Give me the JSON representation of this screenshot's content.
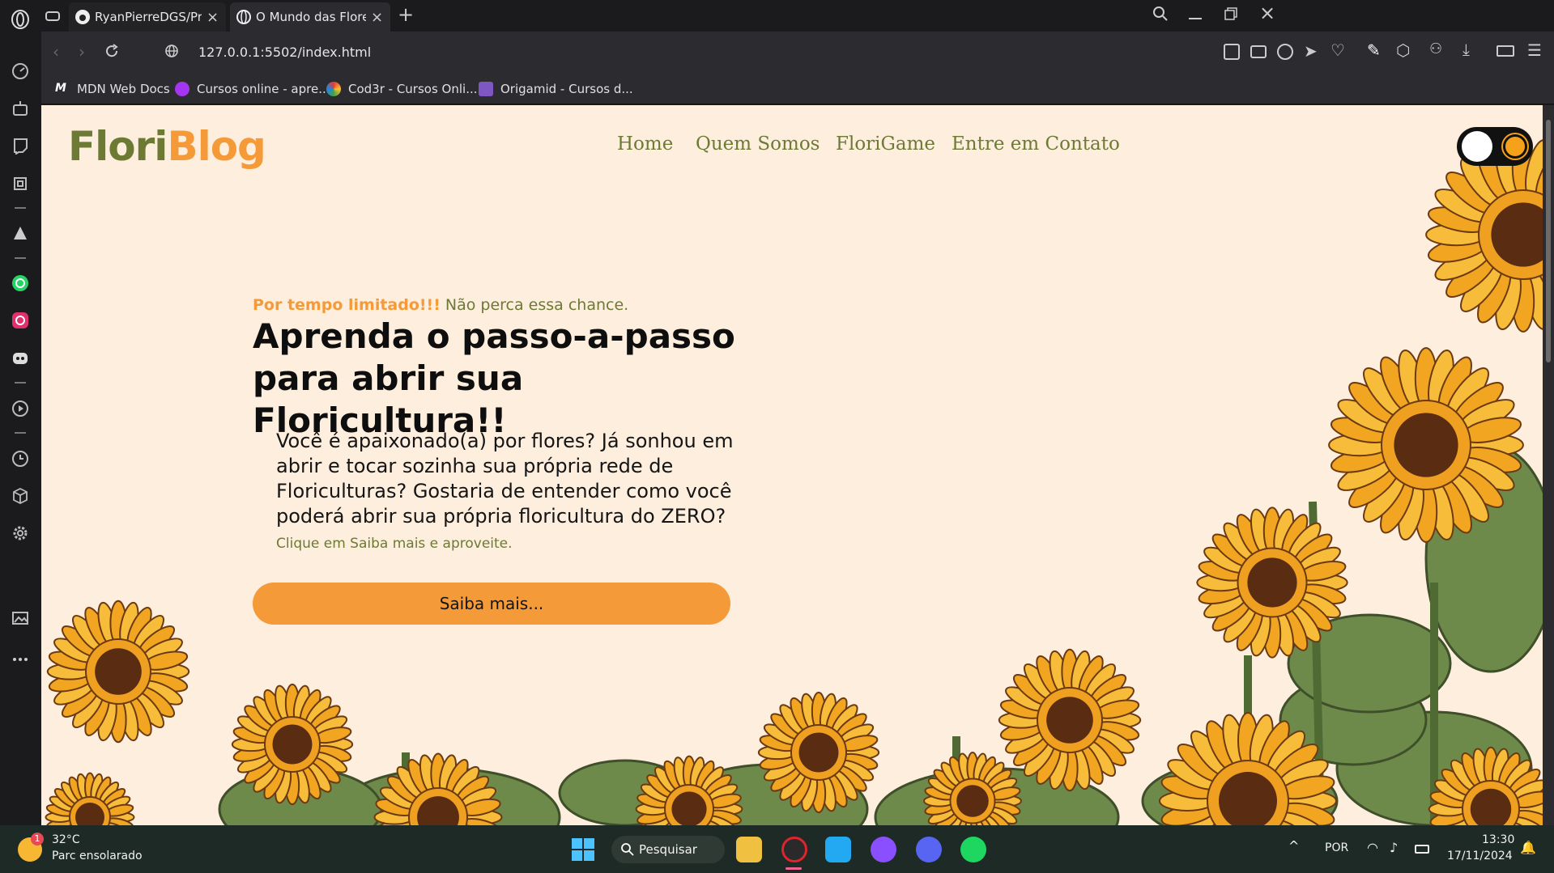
{
  "browser": {
    "tabs": [
      {
        "label": "RyanPierreDGS/Projeto-Inte",
        "active": false
      },
      {
        "label": "O Mundo das Flores || Flori",
        "active": true
      }
    ],
    "url": "127.0.0.1:5502/index.html",
    "bookmarks": [
      {
        "label": "MDN Web Docs",
        "icon": "mdn-icon"
      },
      {
        "label": "Cursos online - apre...",
        "icon": "udemy-icon"
      },
      {
        "label": "Cod3r - Cursos Onli...",
        "icon": "cod3r-icon"
      },
      {
        "label": "Origamid - Cursos d...",
        "icon": "origamid-icon"
      }
    ]
  },
  "site": {
    "logo_part1": "Flori",
    "logo_part2": "Blog",
    "nav": [
      "Home",
      "Quem Somos",
      "FloriGame",
      "Entre em Contato"
    ],
    "promo_highlight": "Por tempo limitado!!!",
    "promo_text": "Não perca essa chance.",
    "headline": "Aprenda o passo-a-passo para abrir sua Floricultura!!",
    "body": "Você é apaixonado(a) por flores? Já sonhou em abrir e tocar sozinha sua própria rede de Floriculturas? Gostaria de entender como você poderá abrir sua própria floricultura do ZERO?",
    "body_cta": "Clique em Saiba mais e aproveite.",
    "button_label": "Saiba mais...",
    "colors": {
      "green": "#6d7a34",
      "orange": "#f59a38",
      "background": "#fdeede"
    }
  },
  "taskbar": {
    "weather_temp": "32°C",
    "weather_desc": "Parc ensolarado",
    "weather_badge": "1",
    "search_label": "Pesquisar",
    "language": "POR",
    "time": "13:30",
    "date": "17/11/2024"
  }
}
